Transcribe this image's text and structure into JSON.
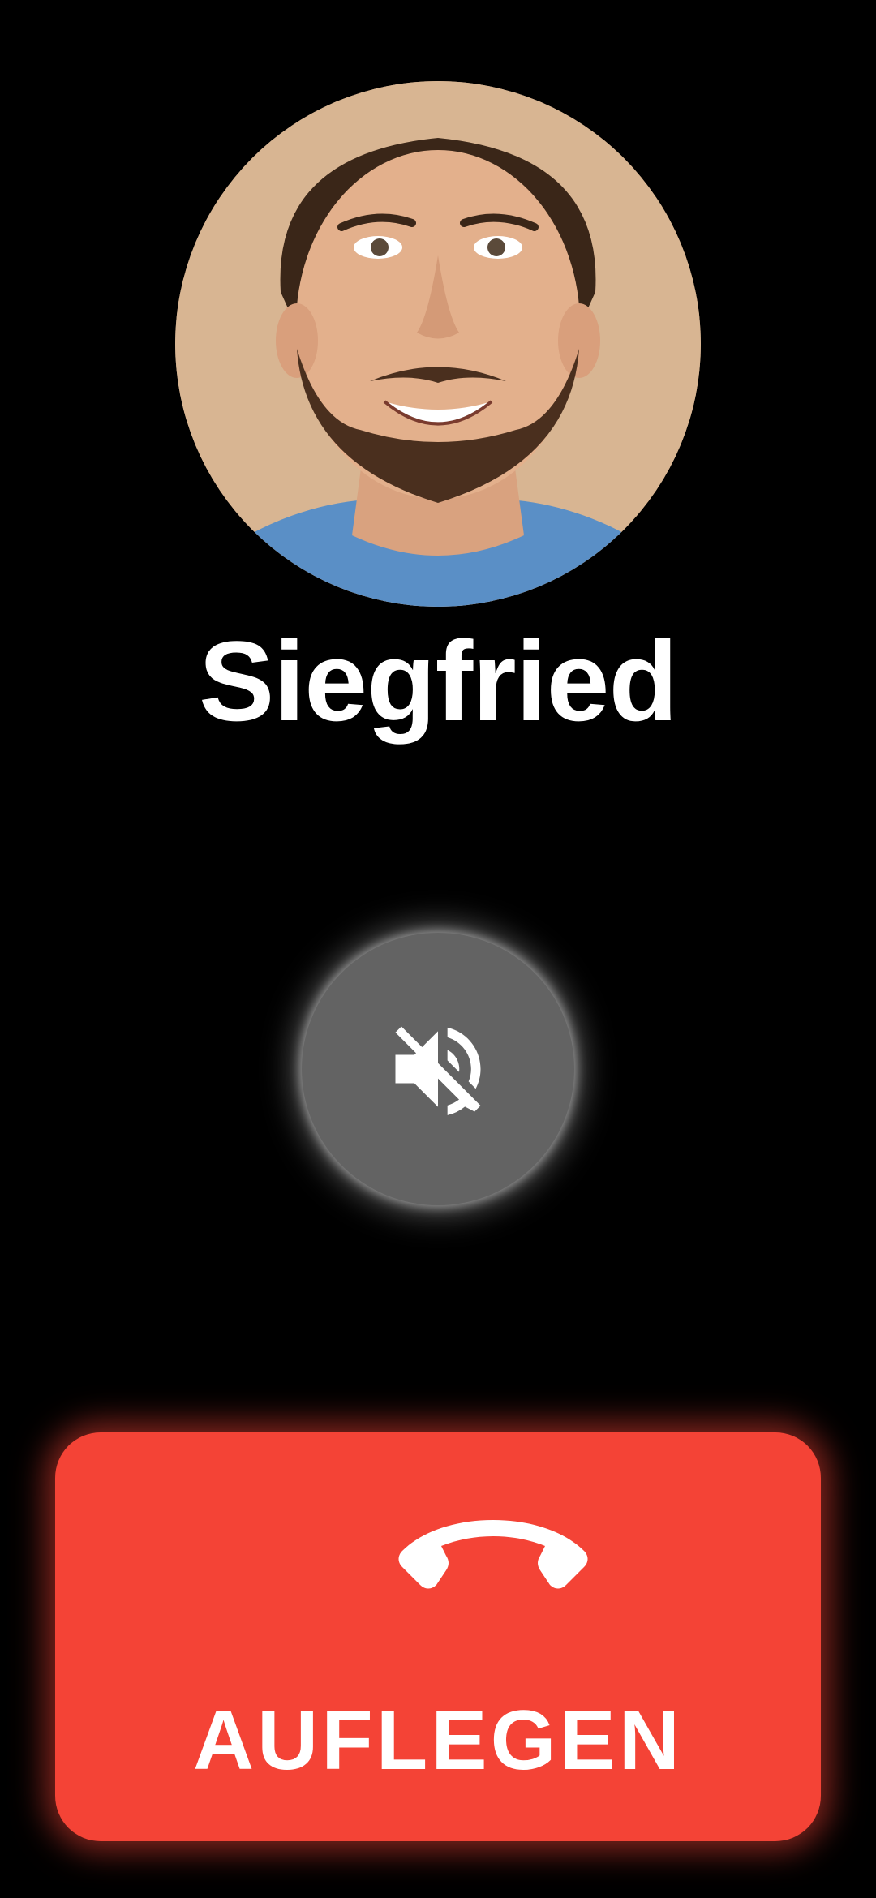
{
  "contact": {
    "name": "Siegfried",
    "avatar_icon": "contact-photo"
  },
  "controls": {
    "mute": {
      "icon": "speaker-muted-icon",
      "color": "#636363"
    },
    "hangup": {
      "label": "AUFLEGEN",
      "icon": "phone-hangup-icon",
      "color": "#f44336"
    }
  }
}
